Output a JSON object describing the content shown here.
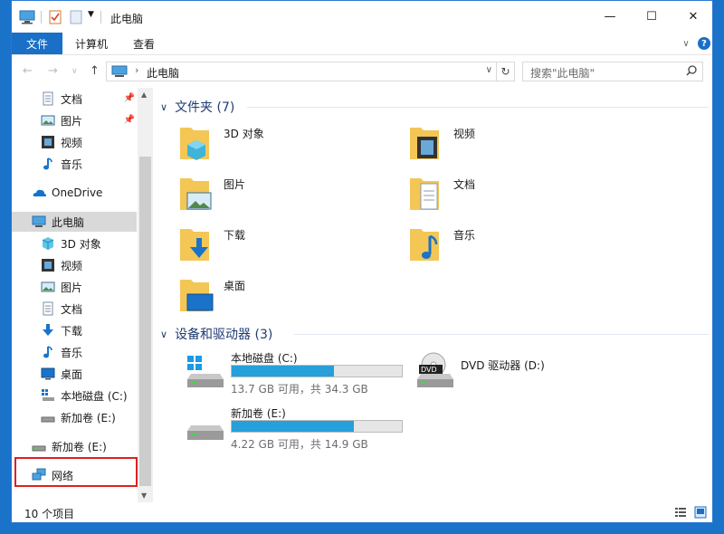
{
  "window": {
    "title": "此电脑",
    "controls": {
      "minimize": "—",
      "maximize": "☐",
      "close": "✕"
    }
  },
  "ribbon": {
    "tabs": [
      "文件",
      "计算机",
      "查看"
    ]
  },
  "address": {
    "path": "此电脑",
    "search_placeholder": "搜索\"此电脑\""
  },
  "nav": {
    "quick_access": [
      {
        "label": "文档",
        "icon": "documents-icon",
        "pinned": true
      },
      {
        "label": "图片",
        "icon": "pictures-icon",
        "pinned": true
      },
      {
        "label": "视频",
        "icon": "videos-icon",
        "pinned": false
      },
      {
        "label": "音乐",
        "icon": "music-icon",
        "pinned": false
      }
    ],
    "onedrive": "OneDrive",
    "this_pc": "此电脑",
    "pc_items": [
      {
        "label": "3D 对象",
        "icon": "3d-objects-icon"
      },
      {
        "label": "视频",
        "icon": "videos-icon"
      },
      {
        "label": "图片",
        "icon": "pictures-icon"
      },
      {
        "label": "文档",
        "icon": "documents-icon"
      },
      {
        "label": "下载",
        "icon": "downloads-icon"
      },
      {
        "label": "音乐",
        "icon": "music-icon"
      },
      {
        "label": "桌面",
        "icon": "desktop-icon"
      },
      {
        "label": "本地磁盘 (C:)",
        "icon": "local-disk-icon"
      },
      {
        "label": "新加卷 (E:)",
        "icon": "drive-icon"
      }
    ],
    "removable": "新加卷 (E:)",
    "network": "网络"
  },
  "folders": {
    "header": "文件夹 (7)",
    "items": [
      {
        "label": "3D 对象",
        "icon": "3d-objects-folder-icon"
      },
      {
        "label": "视频",
        "icon": "videos-folder-icon"
      },
      {
        "label": "图片",
        "icon": "pictures-folder-icon"
      },
      {
        "label": "文档",
        "icon": "documents-folder-icon"
      },
      {
        "label": "下载",
        "icon": "downloads-folder-icon"
      },
      {
        "label": "音乐",
        "icon": "music-folder-icon"
      },
      {
        "label": "桌面",
        "icon": "desktop-folder-icon"
      }
    ]
  },
  "devices": {
    "header": "设备和驱动器 (3)",
    "items": [
      {
        "label": "本地磁盘 (C:)",
        "info": "13.7 GB 可用，共 34.3 GB",
        "used_fraction": 0.6,
        "icon": "windows-disk-icon"
      },
      {
        "label": "DVD 驱动器 (D:)",
        "info": "",
        "icon": "dvd-drive-icon"
      },
      {
        "label": "新加卷 (E:)",
        "info": "4.22 GB 可用，共 14.9 GB",
        "used_fraction": 0.72,
        "icon": "disk-icon"
      }
    ]
  },
  "status": {
    "count": "10 个项目"
  },
  "colors": {
    "accent": "#1a6fc6",
    "bar_fill": "#26a0da",
    "desktop_bg": "#1a73c9",
    "highlight": "#e02020"
  }
}
